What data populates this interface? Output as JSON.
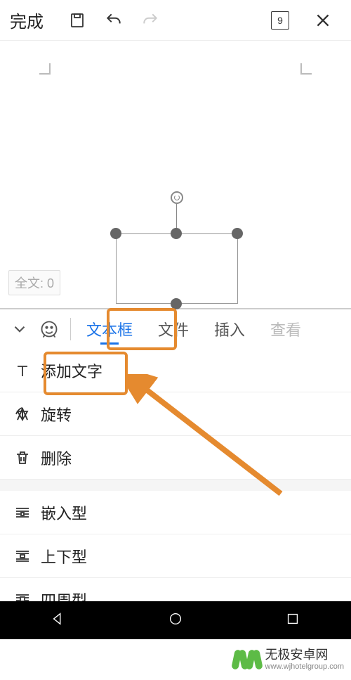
{
  "toolbar": {
    "done_label": "完成",
    "badge_number": "9"
  },
  "canvas": {
    "word_count_label": "全文: 0"
  },
  "tabs": {
    "items": [
      {
        "label": "文本框",
        "active": true
      },
      {
        "label": "文件",
        "active": false
      },
      {
        "label": "插入",
        "active": false
      },
      {
        "label": "查看",
        "active": false
      }
    ]
  },
  "menu": {
    "group1": [
      {
        "icon": "text-icon",
        "label": "添加文字"
      },
      {
        "icon": "rotate-icon",
        "label": "旋转"
      },
      {
        "icon": "delete-icon",
        "label": "删除"
      }
    ],
    "group2": [
      {
        "icon": "wrap-inline-icon",
        "label": "嵌入型"
      },
      {
        "icon": "wrap-topbottom-icon",
        "label": "上下型"
      },
      {
        "icon": "wrap-around-icon",
        "label": "四周型"
      }
    ]
  },
  "watermark": {
    "main": "无极安卓网",
    "sub": "www.wjhotelgroup.com"
  },
  "colors": {
    "accent": "#1a73e8",
    "highlight": "#e58a2f",
    "logo": "#5dbb46"
  }
}
